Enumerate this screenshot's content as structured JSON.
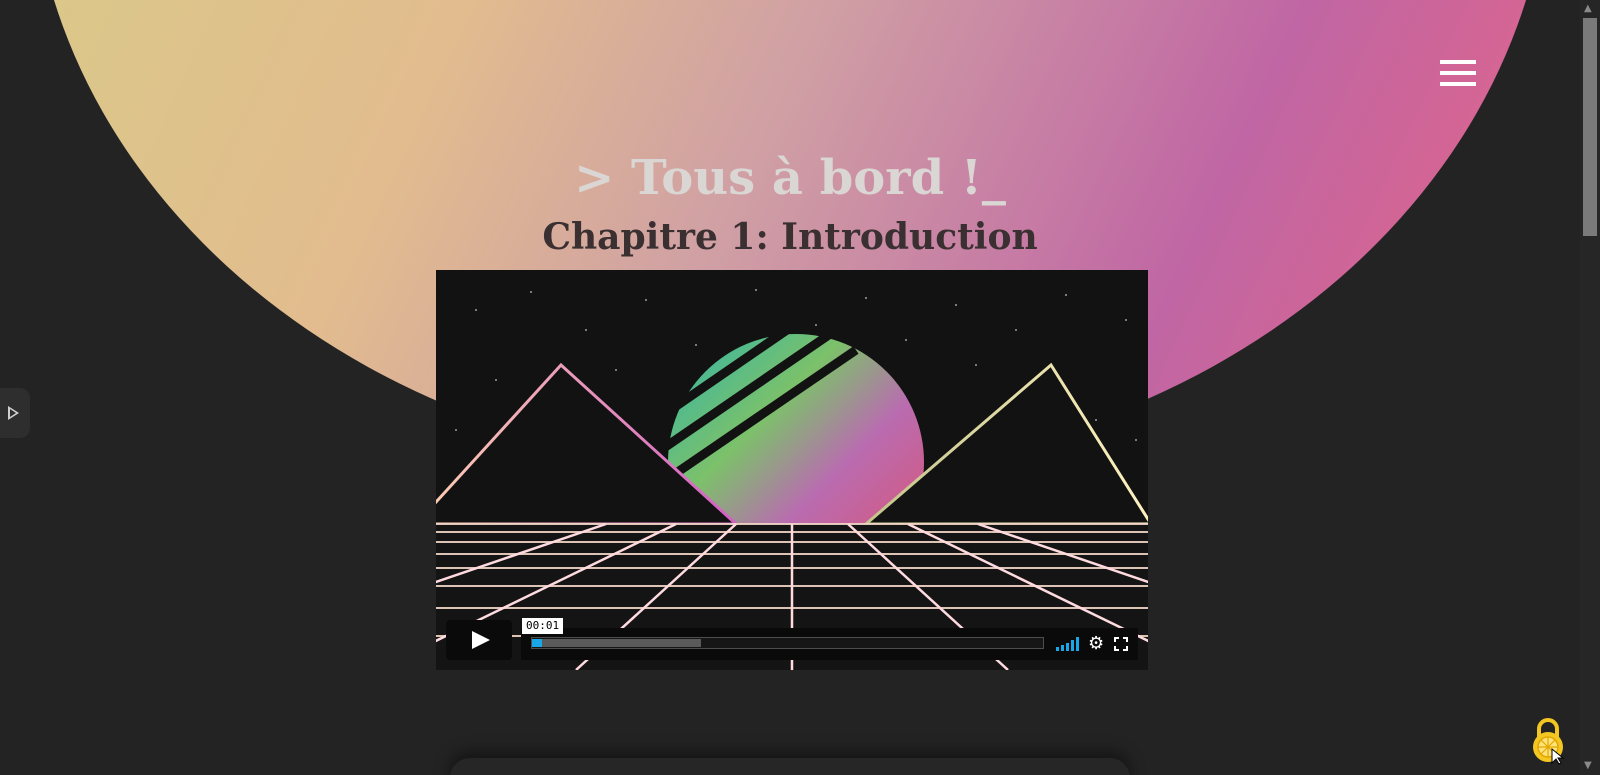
{
  "header": {
    "menu_icon": "hamburger-menu-icon",
    "site_title": "> Tous à bord !_",
    "chapter_title": "Chapitre 1: Introduction"
  },
  "video": {
    "current_time": "00:01",
    "played_fraction": 0.02,
    "buffered_fraction": 0.33,
    "play_icon": "play-icon",
    "volume_icon": "volume-bars-icon",
    "settings_icon": "gear-icon",
    "fullscreen_icon": "fullscreen-icon"
  },
  "side_panel": {
    "toggle_icon": "play-outline-icon"
  },
  "floating": {
    "lock_icon": "padlock-icon"
  },
  "colors": {
    "background": "#232323",
    "gradient_start": "#d8cc88",
    "gradient_mid": "#d0a0a4",
    "gradient_end": "#e26488",
    "progress_accent": "#1aa7e8",
    "lock_yellow": "#f3c622"
  }
}
